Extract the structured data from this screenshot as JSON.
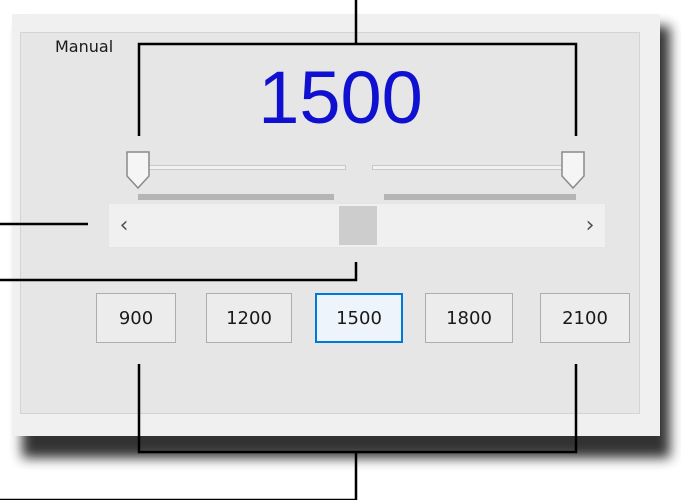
{
  "group": {
    "label": "Manual"
  },
  "display": {
    "value": "1500"
  },
  "scrollbar": {
    "left_arrow": "‹",
    "right_arrow": "›",
    "position_fraction": 0.5
  },
  "presets": [
    {
      "label": "900",
      "active": false
    },
    {
      "label": "1200",
      "active": false
    },
    {
      "label": "1500",
      "active": true
    },
    {
      "label": "1800",
      "active": false
    },
    {
      "label": "2100",
      "active": false
    }
  ],
  "colors": {
    "value_text": "#1010d0",
    "active_border": "#0078d7",
    "callout_line": "#000000"
  }
}
